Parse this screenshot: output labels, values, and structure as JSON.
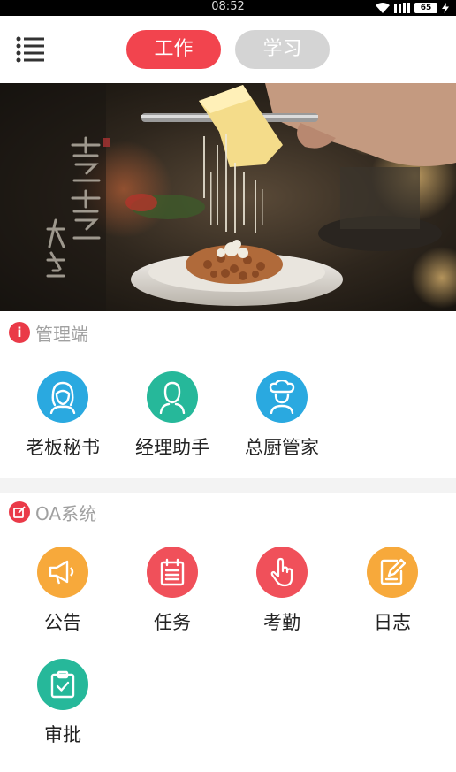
{
  "status_bar": {
    "time": "08:52",
    "battery": "65"
  },
  "header": {
    "tabs": [
      {
        "label": "工作",
        "active": true
      },
      {
        "label": "学习",
        "active": false
      }
    ]
  },
  "banner": {
    "calligraphy": "烹烹 大学"
  },
  "management": {
    "title": "管理端",
    "items": [
      {
        "label": "老板秘书",
        "icon": "woman-avatar-icon",
        "color": "#2aa9e0"
      },
      {
        "label": "经理助手",
        "icon": "man-avatar-icon",
        "color": "#26b89a"
      },
      {
        "label": "总厨管家",
        "icon": "chef-hat-icon",
        "color": "#2aa9e0"
      }
    ]
  },
  "oa": {
    "title": "OA系统",
    "items": [
      {
        "label": "公告",
        "icon": "megaphone-icon",
        "color": "#f7a93b"
      },
      {
        "label": "任务",
        "icon": "calendar-list-icon",
        "color": "#f0505a"
      },
      {
        "label": "考勤",
        "icon": "finger-tap-icon",
        "color": "#f0505a"
      },
      {
        "label": "日志",
        "icon": "edit-notebook-icon",
        "color": "#f7a93b"
      },
      {
        "label": "审批",
        "icon": "clipboard-check-icon",
        "color": "#26b89a"
      }
    ]
  }
}
